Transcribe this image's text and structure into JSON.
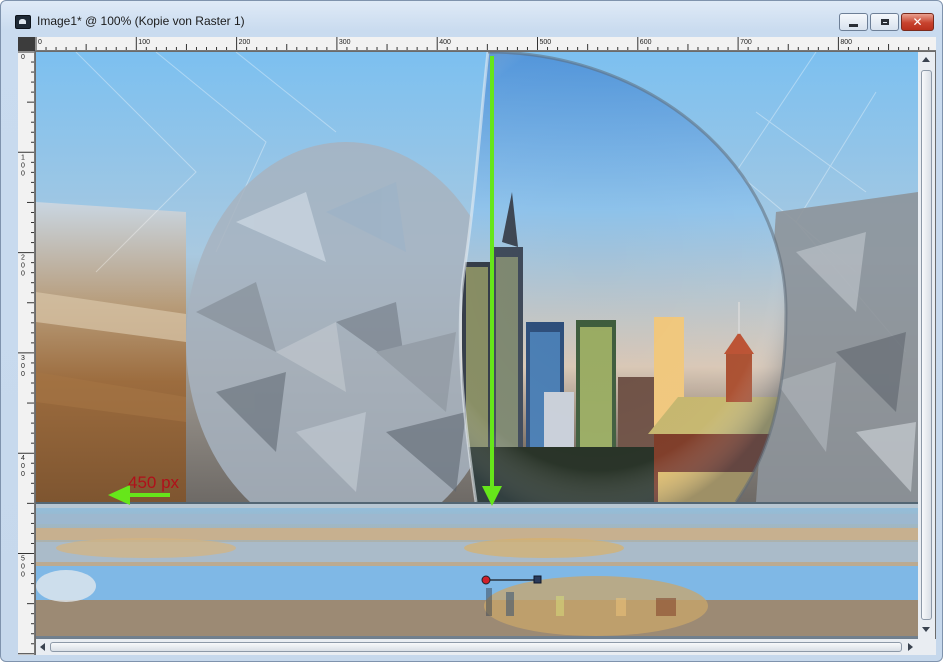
{
  "window": {
    "title": "Image1* @ 100% (Kopie von Raster 1)",
    "controls": {
      "minimize": "minimize",
      "maximize": "maximize",
      "close": "✕"
    }
  },
  "ruler": {
    "horizontal_labels": [
      "0",
      "100",
      "200",
      "300",
      "400",
      "500",
      "600",
      "700",
      "800"
    ],
    "vertical_labels": [
      "0",
      "100",
      "200",
      "300",
      "400",
      "500"
    ]
  },
  "annotation": {
    "label": "450 px",
    "arrow_color": "#66e61a",
    "label_color": "#b0101a"
  },
  "colors": {
    "sky": "#6fb6ec",
    "brown": "#8a5a2e",
    "grey": "#9da3ab",
    "window_frame": "#c6d8ec",
    "canvas_bg": "#6b6b6b"
  }
}
